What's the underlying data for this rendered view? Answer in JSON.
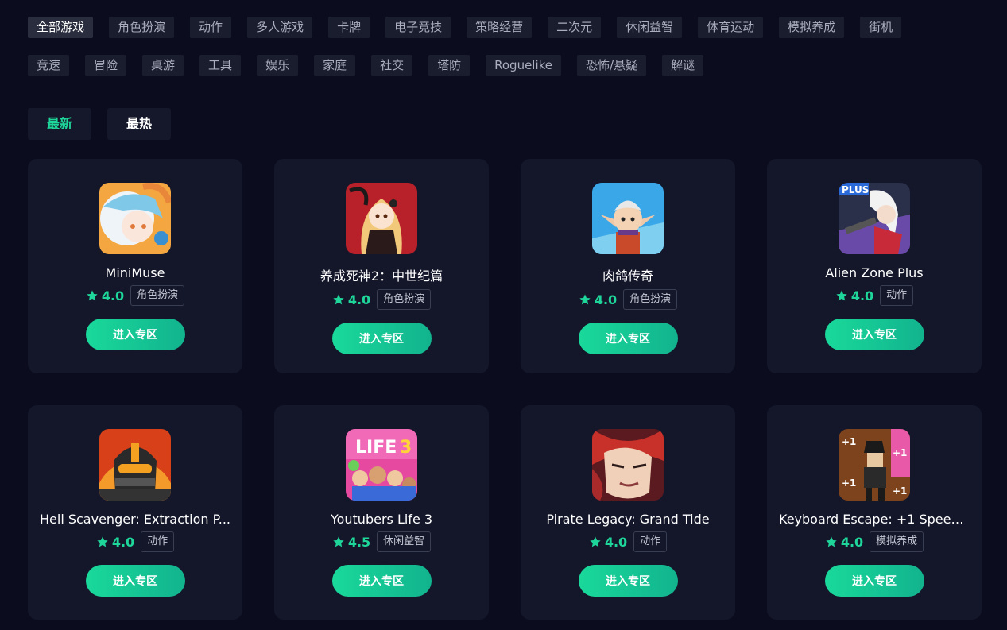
{
  "categories_row1": [
    "全部游戏",
    "角色扮演",
    "动作",
    "多人游戏",
    "卡牌",
    "电子竞技",
    "策略经营",
    "二次元",
    "休闲益智",
    "体育运动",
    "模拟养成",
    "街机"
  ],
  "categories_row2": [
    "竞速",
    "冒险",
    "桌游",
    "工具",
    "娱乐",
    "家庭",
    "社交",
    "塔防",
    "Roguelike",
    "恐怖/悬疑",
    "解谜"
  ],
  "sort": {
    "latest": "最新",
    "hottest": "最热"
  },
  "colors": {
    "accent": "#1fd69a",
    "background": "#0b0d1e",
    "card": "#14172a"
  },
  "games": [
    {
      "title": "MiniMuse",
      "rating": "4.0",
      "tag": "角色扮演",
      "button": "进入专区",
      "icon": "anime-girl-icon"
    },
    {
      "title": "养成死神2：中世纪篇",
      "rating": "4.0",
      "tag": "角色扮演",
      "button": "进入专区",
      "icon": "reaper-girl-icon"
    },
    {
      "title": "肉鸽传奇",
      "rating": "4.0",
      "tag": "角色扮演",
      "button": "进入专区",
      "icon": "elf-warrior-icon"
    },
    {
      "title": "Alien Zone Plus",
      "rating": "4.0",
      "tag": "动作",
      "button": "进入专区",
      "icon": "gunner-girl-icon"
    },
    {
      "title": "Hell Scavenger: Extraction P...",
      "rating": "4.0",
      "tag": "动作",
      "button": "进入专区",
      "icon": "armored-soldier-icon"
    },
    {
      "title": "Youtubers Life 3",
      "rating": "4.5",
      "tag": "休闲益智",
      "button": "进入专区",
      "icon": "youtubers-crowd-icon"
    },
    {
      "title": "Pirate Legacy: Grand Tide",
      "rating": "4.0",
      "tag": "动作",
      "button": "进入专区",
      "icon": "pirate-face-icon"
    },
    {
      "title": "Keyboard Escape: +1 Speed ...",
      "rating": "4.0",
      "tag": "模拟养成",
      "button": "进入专区",
      "icon": "keyboard-runner-icon"
    }
  ]
}
